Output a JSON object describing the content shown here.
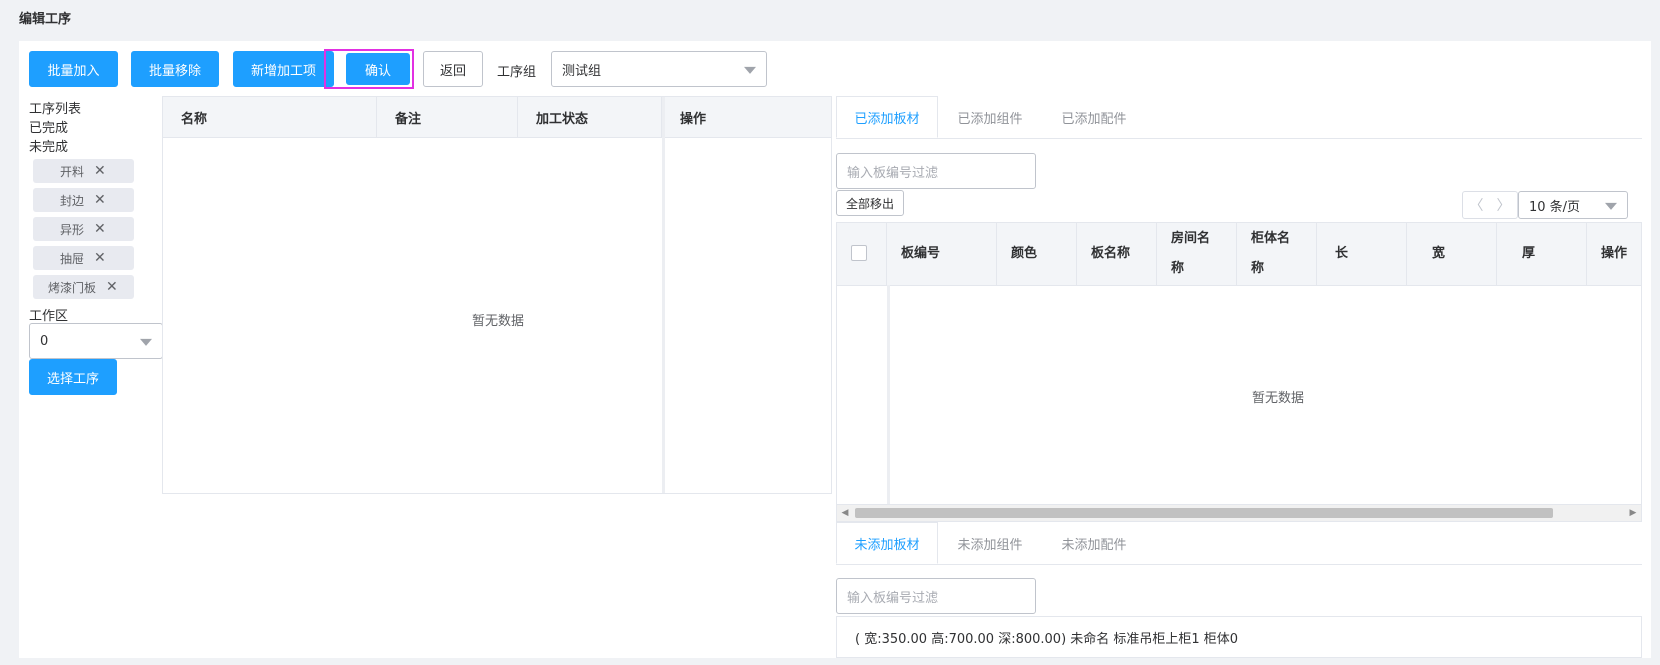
{
  "page": {
    "title": "编辑工序"
  },
  "toolbar": {
    "batch_add": "批量加入",
    "batch_remove": "批量移除",
    "add_process_item": "新增加工项",
    "confirm": "确认",
    "back": "返回",
    "group_label": "工序组",
    "group_value": "测试组"
  },
  "left_panel": {
    "list_label": "工序列表",
    "done_label": "已完成",
    "undone_label": "未完成",
    "tags": [
      "开料",
      "封边",
      "异形",
      "抽屉",
      "烤漆门板"
    ],
    "work_area_label": "工作区",
    "work_area_value": "0",
    "select_process_button": "选择工序"
  },
  "mid_table": {
    "columns": [
      "名称",
      "备注",
      "加工状态",
      "操作"
    ],
    "empty_text": "暂无数据"
  },
  "added_tabs": {
    "tabs": [
      "已添加板材",
      "已添加组件",
      "已添加配件"
    ],
    "active_index": 0,
    "filter_placeholder": "输入板编号过滤",
    "remove_all_button": "全部移出",
    "pagination": {
      "prev": "〈",
      "next": "〉",
      "page_size": "10 条/页"
    },
    "table": {
      "columns": [
        "板编号",
        "颜色",
        "板名称",
        "房间名称",
        "柜体名称",
        "长",
        "宽",
        "厚",
        "操作"
      ],
      "empty_text": "暂无数据"
    }
  },
  "not_added_tabs": {
    "tabs": [
      "未添加板材",
      "未添加组件",
      "未添加配件"
    ],
    "active_index": 0,
    "filter_placeholder": "输入板编号过滤",
    "item_text": "( 宽:350.00 高:700.00 深:800.00) 未命名 标准吊柜上柜1 柜体0"
  },
  "colors": {
    "primary": "#1e9fff",
    "confirm_highlight": "#e230e2"
  }
}
